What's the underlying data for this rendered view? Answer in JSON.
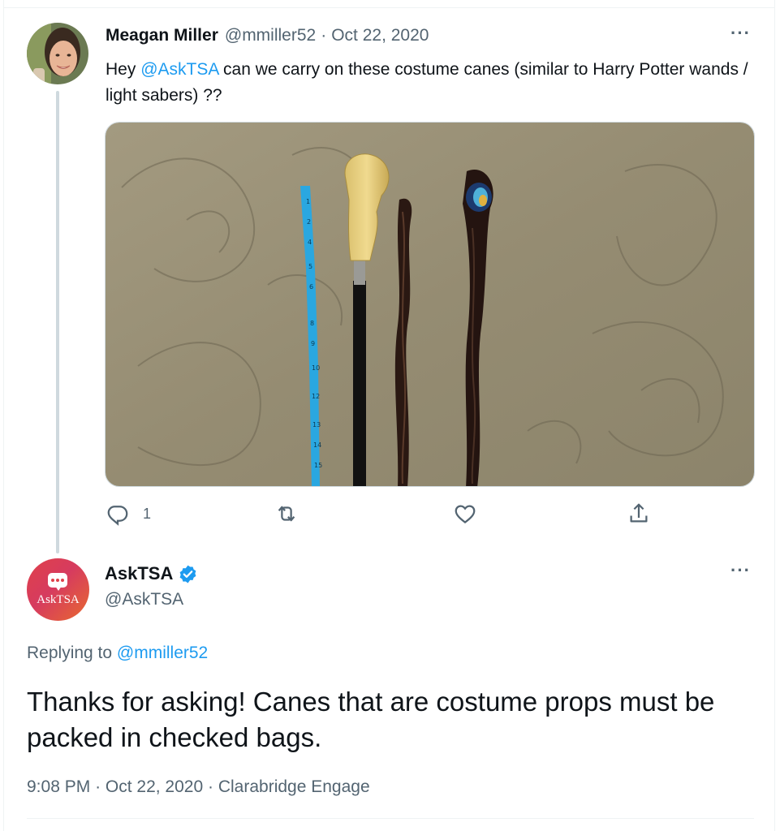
{
  "original_tweet": {
    "author_name": "Meagan Miller",
    "handle": "@mmiller52",
    "separator": "·",
    "date": "Oct 22, 2020",
    "text_before_mention": "Hey ",
    "mention": "@AskTSA",
    "text_after_mention": " can we carry on these costume canes (similar to Harry Potter wands / light sabers) ??",
    "more_icon": "more-horizontal-icon",
    "actions": {
      "reply": {
        "icon": "reply-icon",
        "count": "1"
      },
      "retweet": {
        "icon": "retweet-icon"
      },
      "like": {
        "icon": "heart-icon"
      },
      "share": {
        "icon": "share-icon"
      }
    }
  },
  "reply_tweet": {
    "author_name": "AskTSA",
    "avatar_text": "AskTSA",
    "handle": "@AskTSA",
    "replying_label": "Replying to ",
    "replying_to": "@mmiller52",
    "text": "Thanks for asking! Canes that are costume props must be packed in checked bags.",
    "time": "9:08 PM",
    "separator": "·",
    "date": "Oct 22, 2020",
    "source": "Clarabridge Engage",
    "more_icon": "more-horizontal-icon",
    "verified_icon": "verified-badge-icon"
  },
  "colors": {
    "link": "#1d9bf0",
    "secondary_text": "#536471",
    "primary_text": "#0f1419",
    "thread_line": "#cfd9de"
  }
}
